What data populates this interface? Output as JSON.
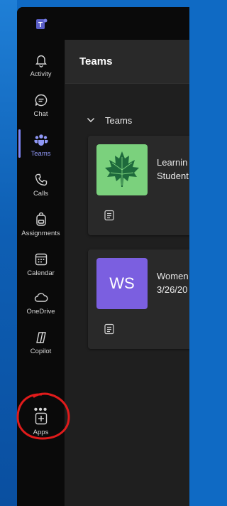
{
  "rail": {
    "items": [
      {
        "label": "Activity",
        "icon": "bell-icon"
      },
      {
        "label": "Chat",
        "icon": "chat-icon"
      },
      {
        "label": "Teams",
        "icon": "teams-icon",
        "active": true
      },
      {
        "label": "Calls",
        "icon": "phone-icon"
      },
      {
        "label": "Assignments",
        "icon": "backpack-icon"
      },
      {
        "label": "Calendar",
        "icon": "calendar-icon"
      },
      {
        "label": "OneDrive",
        "icon": "cloud-icon"
      },
      {
        "label": "Copilot",
        "icon": "copilot-icon"
      },
      {
        "label": "Apps",
        "icon": "add-apps-icon"
      }
    ],
    "more_label": "•••"
  },
  "main": {
    "title": "Teams",
    "section_label": "Teams",
    "cards": [
      {
        "line1": "Learnin",
        "line2": "Student",
        "avatar": "maple-leaf"
      },
      {
        "line1": "Women",
        "line2": "3/26/20",
        "avatar_text": "WS"
      }
    ]
  },
  "colors": {
    "accent": "#7f85f5",
    "annotation": "#e01b1b",
    "teams_logo": "#5b5fc7"
  }
}
